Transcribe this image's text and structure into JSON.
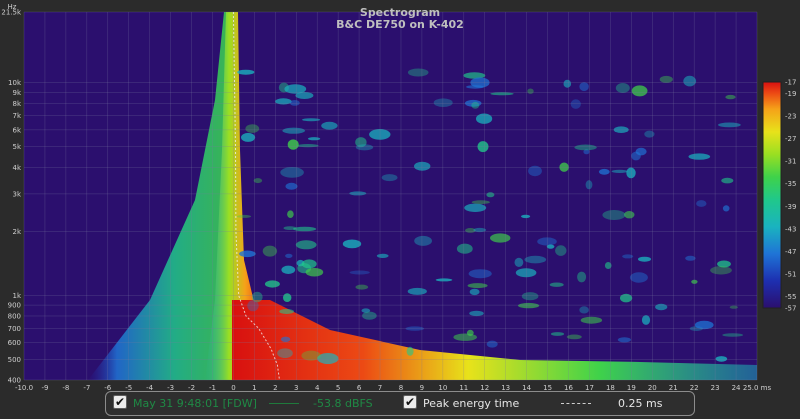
{
  "chart_data": {
    "type": "heatmap",
    "title": "Spectrogram",
    "subtitle": "B&C DE750 on K-402",
    "y_unit": "Hz",
    "y_scale": "log",
    "xlim": [
      -10.0,
      25.0
    ],
    "ylim": [
      400,
      21500
    ],
    "x_ticks": [
      {
        "v": -10,
        "label": "-10.0"
      },
      {
        "v": -9,
        "label": "-9"
      },
      {
        "v": -8,
        "label": "-8"
      },
      {
        "v": -7,
        "label": "-7"
      },
      {
        "v": -6,
        "label": "-6"
      },
      {
        "v": -5,
        "label": "-5"
      },
      {
        "v": -4,
        "label": "-4"
      },
      {
        "v": -3,
        "label": "-3"
      },
      {
        "v": -2,
        "label": "-2"
      },
      {
        "v": -1,
        "label": "-1"
      },
      {
        "v": 0,
        "label": "0"
      },
      {
        "v": 1,
        "label": "1"
      },
      {
        "v": 2,
        "label": "2"
      },
      {
        "v": 3,
        "label": "3"
      },
      {
        "v": 4,
        "label": "4"
      },
      {
        "v": 5,
        "label": "5"
      },
      {
        "v": 6,
        "label": "6"
      },
      {
        "v": 7,
        "label": "7"
      },
      {
        "v": 8,
        "label": "8"
      },
      {
        "v": 9,
        "label": "9"
      },
      {
        "v": 10,
        "label": "10"
      },
      {
        "v": 11,
        "label": "11"
      },
      {
        "v": 12,
        "label": "12"
      },
      {
        "v": 13,
        "label": "13"
      },
      {
        "v": 14,
        "label": "14"
      },
      {
        "v": 15,
        "label": "15"
      },
      {
        "v": 16,
        "label": "16"
      },
      {
        "v": 17,
        "label": "17"
      },
      {
        "v": 18,
        "label": "18"
      },
      {
        "v": 19,
        "label": "19"
      },
      {
        "v": 20,
        "label": "20"
      },
      {
        "v": 21,
        "label": "21"
      },
      {
        "v": 22,
        "label": "22"
      },
      {
        "v": 23,
        "label": "23"
      },
      {
        "v": 24,
        "label": "24"
      },
      {
        "v": 25,
        "label": "25.0 ms"
      }
    ],
    "y_ticks": [
      {
        "v": 400,
        "label": "400"
      },
      {
        "v": 500,
        "label": "500"
      },
      {
        "v": 600,
        "label": "600"
      },
      {
        "v": 700,
        "label": "700"
      },
      {
        "v": 800,
        "label": "800"
      },
      {
        "v": 900,
        "label": "900"
      },
      {
        "v": 1000,
        "label": "1k"
      },
      {
        "v": 2000,
        "label": "2k"
      },
      {
        "v": 3000,
        "label": "3k"
      },
      {
        "v": 4000,
        "label": "4k"
      },
      {
        "v": 5000,
        "label": "5k"
      },
      {
        "v": 6000,
        "label": "6k"
      },
      {
        "v": 7000,
        "label": "7k"
      },
      {
        "v": 8000,
        "label": "8k"
      },
      {
        "v": 9000,
        "label": "9k"
      },
      {
        "v": 10000,
        "label": "10k"
      },
      {
        "v": 21500,
        "label": "21.5k"
      }
    ],
    "colorbar": {
      "range": [
        -57,
        -17
      ],
      "ticks": [
        "-17",
        "-19",
        "-23",
        "-27",
        "-31",
        "-35",
        "-39",
        "-43",
        "-47",
        "-51",
        "-55",
        "-57"
      ],
      "tick_values": [
        -17,
        -19,
        -23,
        -27,
        -31,
        -35,
        -39,
        -43,
        -47,
        -51,
        -55,
        -57
      ],
      "colors": [
        "#2b0f6e",
        "#1d2fb0",
        "#1f74d6",
        "#1ab3bf",
        "#20c88a",
        "#3fd24a",
        "#9adf22",
        "#e8e21a",
        "#f5a219",
        "#ec4a14",
        "#d81010"
      ]
    },
    "peak_energy_curve": [
      {
        "x": 0.0,
        "y": 21500
      },
      {
        "x": 0.05,
        "y": 10000
      },
      {
        "x": 0.1,
        "y": 5000
      },
      {
        "x": 0.12,
        "y": 2000
      },
      {
        "x": 0.25,
        "y": 1000
      },
      {
        "x": 0.6,
        "y": 800
      },
      {
        "x": 1.2,
        "y": 700
      },
      {
        "x": 1.8,
        "y": 560
      },
      {
        "x": 2.1,
        "y": 470
      },
      {
        "x": 2.2,
        "y": 400
      }
    ],
    "grid": true,
    "background_color": "#2b0f6e"
  },
  "legend": {
    "series1": {
      "checked": true,
      "label": "May 31 9:48:01 [FDW]",
      "value": "-53.8 dBFS",
      "color": "#1f7a3c"
    },
    "series2": {
      "checked": true,
      "label": "Peak energy time",
      "value": "0.25 ms",
      "color": "#e8e8e8"
    }
  },
  "colors": {
    "axis_text": "#cfcfcf",
    "title": "#bfbfbf",
    "grid": "#7a7aa0"
  }
}
